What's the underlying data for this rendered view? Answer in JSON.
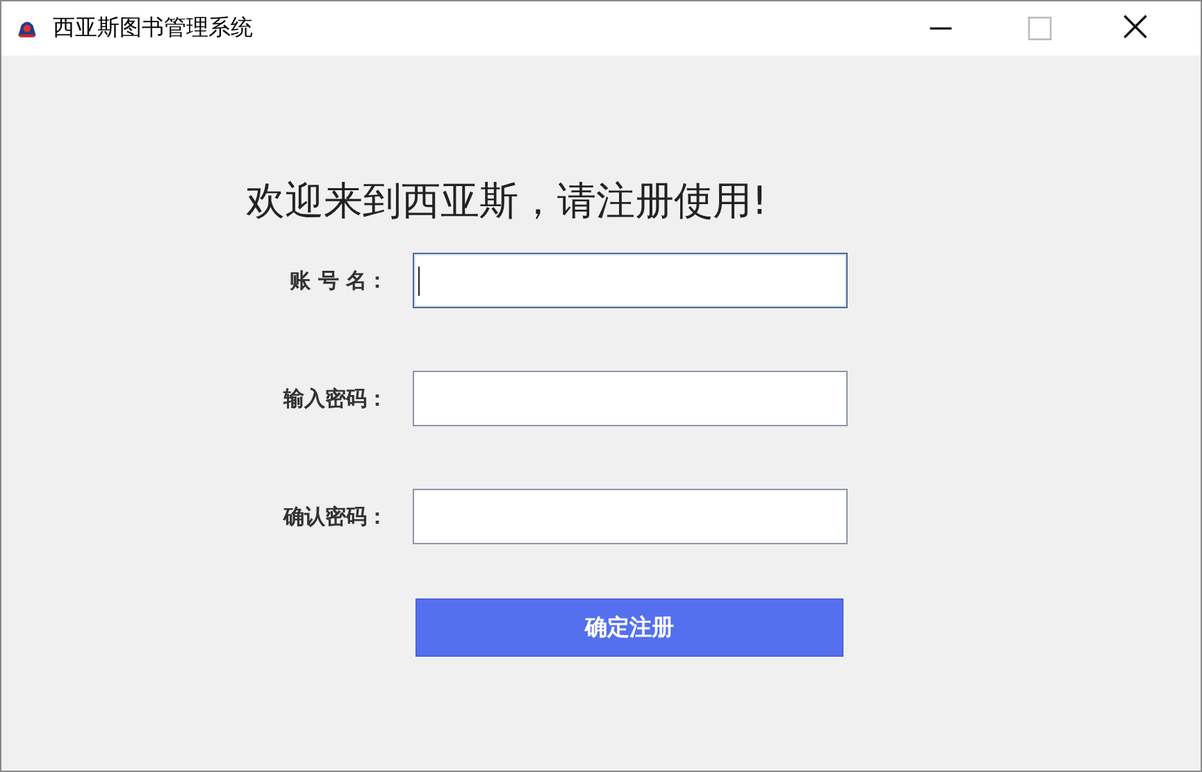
{
  "window": {
    "title": "西亚斯图书管理系统"
  },
  "heading": "欢迎来到西亚斯，请注册使用!",
  "fields": [
    {
      "label": "账 号 名：",
      "focused": true
    },
    {
      "label": "输入密码：",
      "focused": false
    },
    {
      "label": "确认密码：",
      "focused": false
    }
  ],
  "submit_button": "确定注册"
}
